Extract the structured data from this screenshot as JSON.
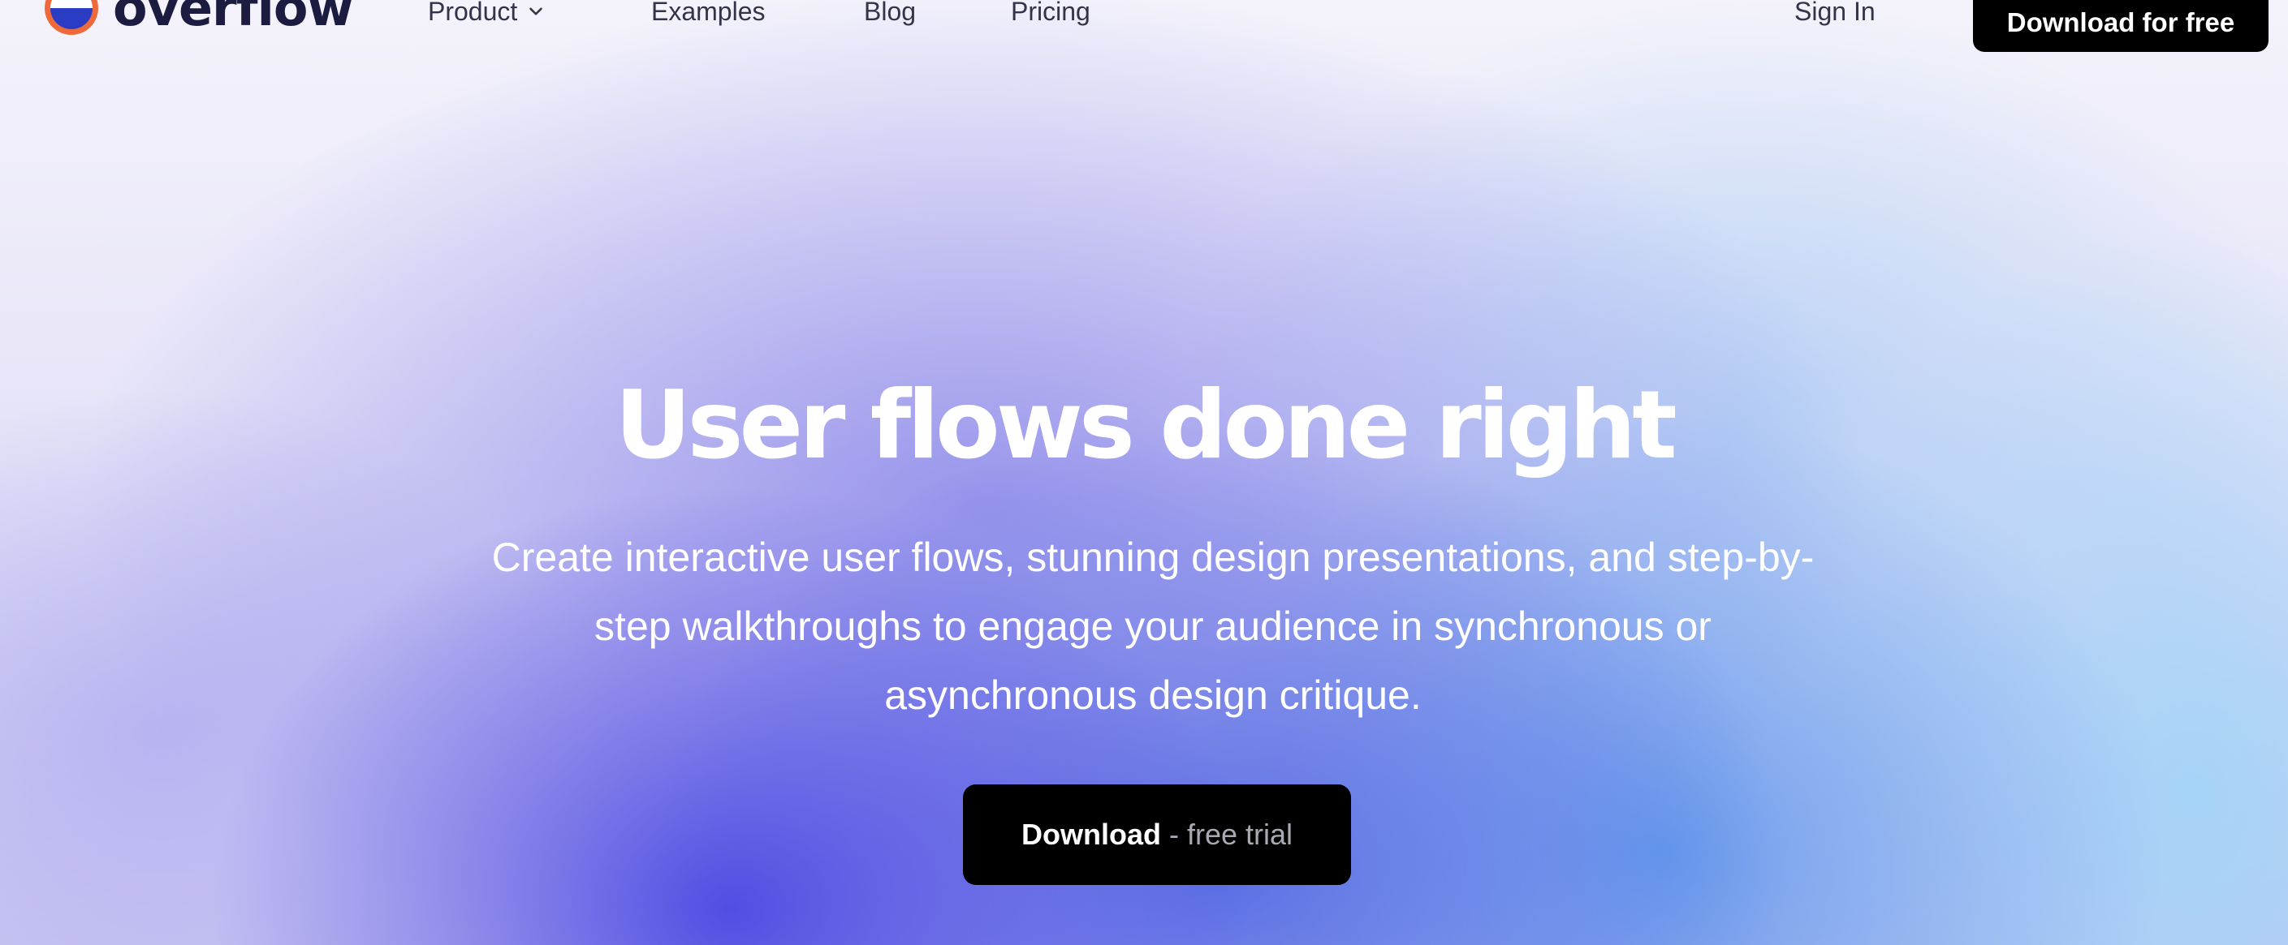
{
  "brand": {
    "name": "overflow",
    "colors": {
      "outer": "#ef6a3a",
      "inner": "#2b3cc4"
    }
  },
  "nav": {
    "links": [
      {
        "label": "Product",
        "has_dropdown": true
      },
      {
        "label": "Examples"
      },
      {
        "label": "Blog"
      },
      {
        "label": "Pricing"
      }
    ],
    "sign_in": "Sign In",
    "download": "Download for free"
  },
  "hero": {
    "title": "User flows done right",
    "subtitle_lines": [
      "Create interactive user flows, stunning design presentations, and step-by-",
      "step walkthroughs to engage your audience in synchronous or",
      "asynchronous design critique."
    ],
    "cta": {
      "primary": "Download",
      "secondary": "- free trial"
    }
  },
  "icons": {
    "dropdown": "chevron-down-icon",
    "logo": "overflow-logo-mark"
  }
}
